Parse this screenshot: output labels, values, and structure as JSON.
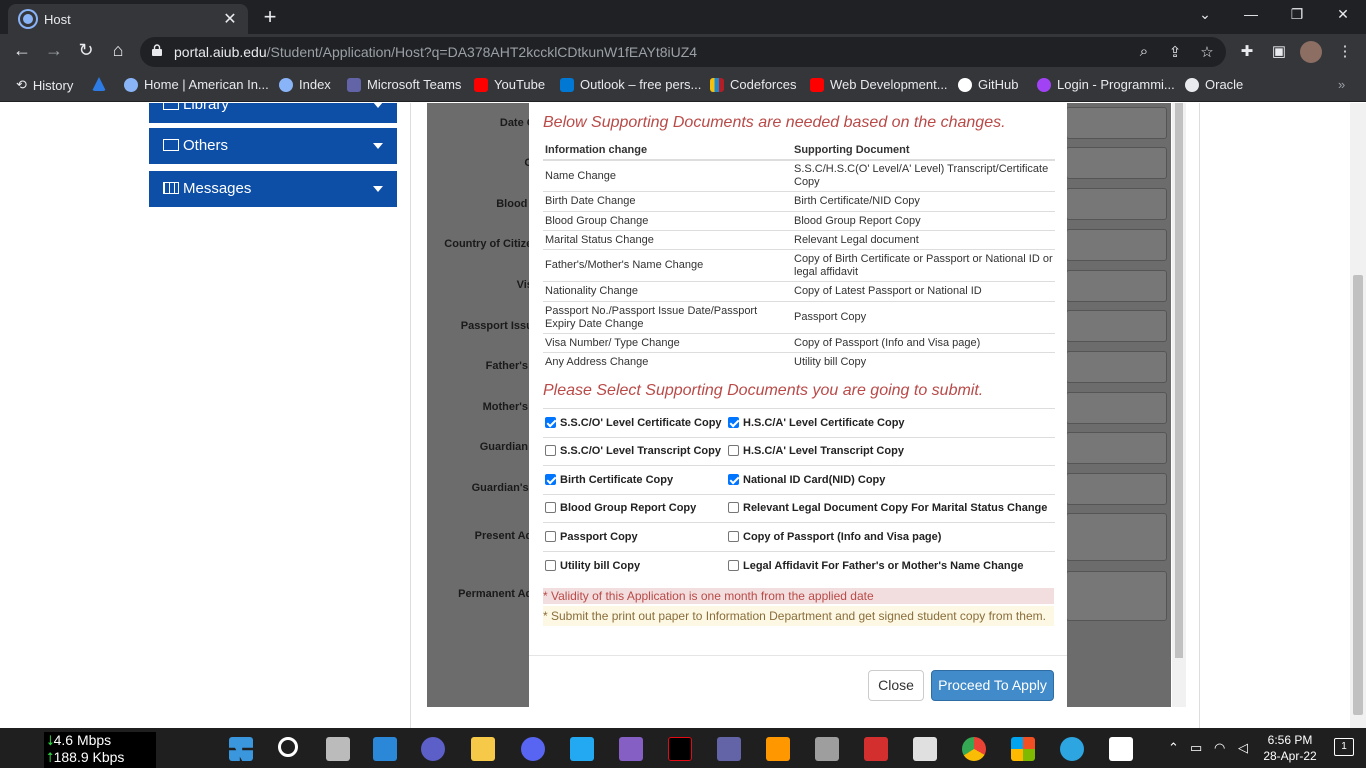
{
  "browser": {
    "tab_title": "Host",
    "url_host": "portal.aiub.edu",
    "url_path": "/Student/Application/Host?q=DA378AHT2kccklCDtkunW1fEAYt8iUZ4",
    "bookmarks": [
      {
        "label": "History",
        "color": "#e8eaed"
      },
      {
        "label": "",
        "color": "#2d7be5"
      },
      {
        "label": "Home | American In...",
        "color": "#8ab4f8"
      },
      {
        "label": "Index",
        "color": "#8ab4f8"
      },
      {
        "label": "Microsoft Teams",
        "color": "#6264a7"
      },
      {
        "label": "YouTube",
        "color": "#ff0000"
      },
      {
        "label": "Outlook – free pers...",
        "color": "#0078d4"
      },
      {
        "label": "Codeforces",
        "color": "#f4c20d"
      },
      {
        "label": "Web Development...",
        "color": "#ff0000"
      },
      {
        "label": "GitHub",
        "color": "#ffffff"
      },
      {
        "label": "Login - Programmi...",
        "color": "#a142f4"
      },
      {
        "label": "Oracle",
        "color": "#e8eaed"
      }
    ]
  },
  "sidebar": {
    "items": [
      {
        "label": "Library"
      },
      {
        "label": "Others"
      },
      {
        "label": "Messages"
      }
    ]
  },
  "form": {
    "labels": [
      "Date Of",
      "Ge",
      "Blood G",
      "Country of Citizen",
      "Visa",
      "Passport Issue",
      "Father's N",
      "Mother's N",
      "Guardian N",
      "Guardian's E",
      "Present Add",
      "Permanent Add"
    ]
  },
  "modal": {
    "heading_needed": "Below Supporting Documents are needed based on the changes.",
    "table_headers": [
      "Information change",
      "Supporting Document"
    ],
    "table_rows": [
      [
        "Name Change",
        "S.S.C/H.S.C(O' Level/A' Level) Transcript/Certificate Copy"
      ],
      [
        "Birth Date Change",
        "Birth Certificate/NID Copy"
      ],
      [
        "Blood Group Change",
        "Blood Group Report Copy"
      ],
      [
        "Marital Status Change",
        "Relevant Legal document"
      ],
      [
        "Father's/Mother's Name Change",
        "Copy of Birth Certificate or Passport or National ID or legal affidavit"
      ],
      [
        "Nationality Change",
        "Copy of Latest Passport or National ID"
      ],
      [
        "Passport No./Passport Issue Date/Passport Expiry Date Change",
        "Passport Copy"
      ],
      [
        "Visa Number/ Type Change",
        "Copy of Passport (Info and Visa page)"
      ],
      [
        "Any Address Change",
        "Utility bill Copy"
      ]
    ],
    "heading_select": "Please Select Supporting Documents you are going to submit.",
    "checkboxes": [
      [
        {
          "label": "S.S.C/O' Level Certificate Copy",
          "checked": true
        },
        {
          "label": "H.S.C/A' Level Certificate Copy",
          "checked": true
        }
      ],
      [
        {
          "label": "S.S.C/O' Level Transcript Copy",
          "checked": false
        },
        {
          "label": "H.S.C/A' Level Transcript Copy",
          "checked": false
        }
      ],
      [
        {
          "label": "Birth Certificate Copy",
          "checked": true
        },
        {
          "label": "National ID Card(NID) Copy",
          "checked": true
        }
      ],
      [
        {
          "label": "Blood Group Report Copy",
          "checked": false
        },
        {
          "label": "Relevant Legal Document Copy For Marital Status Change",
          "checked": false
        }
      ],
      [
        {
          "label": "Passport Copy",
          "checked": false
        },
        {
          "label": "Copy of Passport (Info and Visa page)",
          "checked": false
        }
      ],
      [
        {
          "label": "Utility bill Copy",
          "checked": false
        },
        {
          "label": "Legal Affidavit For Father's or Mother's Name Change",
          "checked": false
        }
      ]
    ],
    "note_validity": "* Validity of this Application is one month from the applied date",
    "note_submit": "* Submit the print out paper to Information Department and get signed student copy from them.",
    "close_label": "Close",
    "apply_label": "Proceed To Apply"
  },
  "taskbar": {
    "download": "4.6 Mbps",
    "upload": "188.9 Kbps",
    "time": "6:56 PM",
    "date": "28-Apr-22",
    "notification_count": "1"
  }
}
